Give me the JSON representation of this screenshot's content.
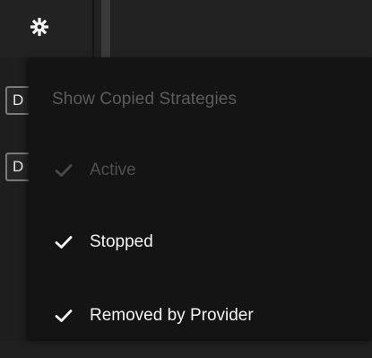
{
  "toolbar": {
    "settings_icon": "gear-icon"
  },
  "background_tabs": [
    {
      "label": "D"
    },
    {
      "label": "D"
    }
  ],
  "menu": {
    "header": "Show Copied Strategies",
    "items": [
      {
        "label": "Active",
        "checked": true,
        "enabled": false
      },
      {
        "label": "Stopped",
        "checked": true,
        "enabled": true
      },
      {
        "label": "Removed by Provider",
        "checked": true,
        "enabled": true
      }
    ]
  },
  "colors": {
    "menu_bg": "#141414",
    "enabled_text": "#f4f4f4",
    "disabled_text": "#4f4f4f",
    "header_text": "#5c5c5c"
  }
}
